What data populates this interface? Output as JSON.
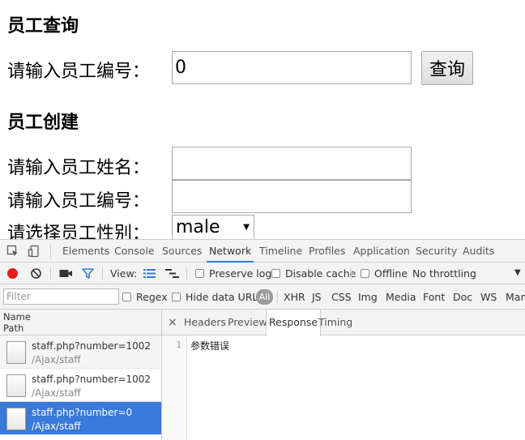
{
  "page": {
    "query_heading": "员工查询",
    "query_label": "请输入员工编号：",
    "query_value": "0",
    "query_button": "查询",
    "create_heading": "员工创建",
    "name_label": "请输入员工姓名：",
    "number_label": "请输入员工编号：",
    "gender_label": "请选择员工性别：",
    "gender_selected": "male"
  },
  "devtools": {
    "tabs": [
      "Elements",
      "Console",
      "Sources",
      "Network",
      "Timeline",
      "Profiles",
      "Application",
      "Security",
      "Audits"
    ],
    "active_tab": "Network",
    "toolbar": {
      "view_label": "View:",
      "preserve_log": "Preserve log",
      "disable_cache": "Disable cache",
      "offline": "Offline",
      "throttling": "No throttling"
    },
    "filter_bar": {
      "placeholder": "Filter",
      "regex": "Regex",
      "hide_data_urls": "Hide data URLs",
      "types": [
        "All",
        "XHR",
        "JS",
        "CSS",
        "Img",
        "Media",
        "Font",
        "Doc",
        "WS",
        "Man"
      ]
    },
    "requests_header": {
      "name": "Name",
      "path": "Path"
    },
    "requests": [
      {
        "name": "staff.php?number=1002",
        "path": "/Ajax/staff"
      },
      {
        "name": "staff.php?number=1002",
        "path": "/Ajax/staff"
      },
      {
        "name": "staff.php?number=0",
        "path": "/Ajax/staff"
      }
    ],
    "detail_tabs": [
      "Headers",
      "Preview",
      "Response",
      "Timing"
    ],
    "active_detail_tab": "Response",
    "close_glyph": "×",
    "response_line_number": "1",
    "response_text": "参数错误"
  },
  "colors": {
    "selected_row": "#3879d9",
    "record_button": "#e81c1c",
    "filter_icon": "#3879d9"
  }
}
